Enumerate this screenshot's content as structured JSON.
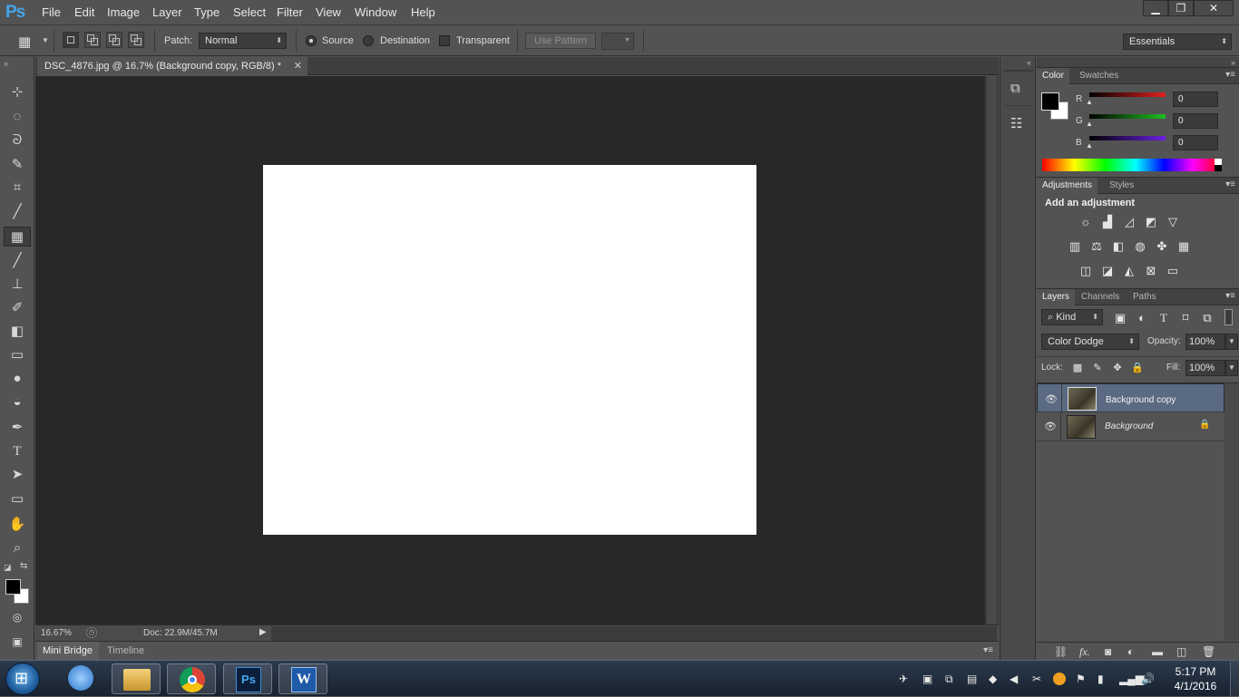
{
  "app": {
    "logo": "Ps",
    "menu": [
      "File",
      "Edit",
      "Image",
      "Layer",
      "Type",
      "Select",
      "Filter",
      "View",
      "Window",
      "Help"
    ],
    "window_controls": [
      "minimize",
      "restore",
      "close"
    ]
  },
  "options_bar": {
    "patch_label": "Patch:",
    "patch_mode": "Normal",
    "source_label": "Source",
    "destination_label": "Destination",
    "transparent_label": "Transparent",
    "source_selected": true,
    "transparent_checked": false,
    "use_pattern_label": "Use Pattern",
    "workspace": "Essentials"
  },
  "document": {
    "tab_title": "DSC_4876.jpg @ 16.7% (Background copy, RGB/8) *",
    "zoom": "16.67%",
    "doc_size": "Doc: 22.9M/45.7M"
  },
  "bottom_tabs": [
    "Mini Bridge",
    "Timeline"
  ],
  "color_panel": {
    "tabs": [
      "Color",
      "Swatches"
    ],
    "channels": [
      {
        "label": "R",
        "value": "0",
        "color": "#e02020"
      },
      {
        "label": "G",
        "value": "0",
        "color": "#20c020"
      },
      {
        "label": "B",
        "value": "0",
        "color": "#6a20e0"
      }
    ]
  },
  "adjustments_panel": {
    "tabs": [
      "Adjustments",
      "Styles"
    ],
    "heading": "Add an adjustment"
  },
  "layers_panel": {
    "tabs": [
      "Layers",
      "Channels",
      "Paths"
    ],
    "filter_kind": "Kind",
    "blend_mode": "Color Dodge",
    "opacity_label": "Opacity:",
    "opacity": "100%",
    "lock_label": "Lock:",
    "fill_label": "Fill:",
    "fill": "100%",
    "layers": [
      {
        "name": "Background copy",
        "selected": true,
        "locked": false
      },
      {
        "name": "Background",
        "selected": false,
        "locked": true
      }
    ],
    "footer_fx": "fx."
  },
  "taskbar": {
    "time": "5:17 PM",
    "date": "4/1/2016",
    "apps": [
      "windows-explorer",
      "chrome",
      "photoshop",
      "word"
    ]
  }
}
